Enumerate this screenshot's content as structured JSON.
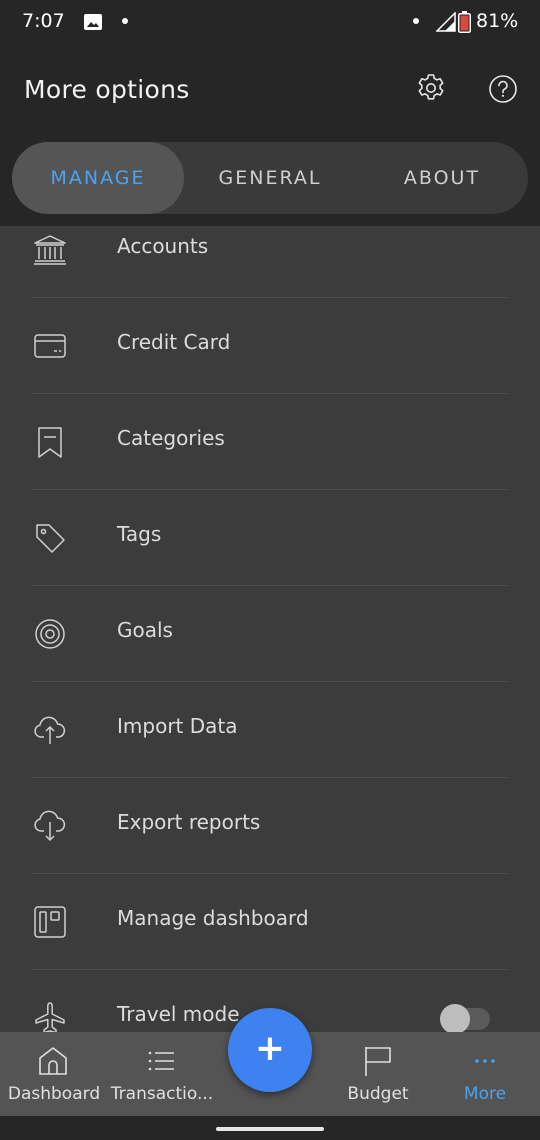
{
  "status_bar": {
    "time": "7:07",
    "battery": "81%"
  },
  "header": {
    "title": "More options",
    "settings_icon": "gear-icon",
    "help_icon": "help-icon"
  },
  "tabs": [
    {
      "label": "MANAGE",
      "active": true
    },
    {
      "label": "GENERAL",
      "active": false
    },
    {
      "label": "ABOUT",
      "active": false
    }
  ],
  "menu": [
    {
      "label": "Accounts",
      "icon": "bank-icon"
    },
    {
      "label": "Credit Card",
      "icon": "credit-card-icon"
    },
    {
      "label": "Categories",
      "icon": "bookmark-icon"
    },
    {
      "label": "Tags",
      "icon": "tag-icon"
    },
    {
      "label": "Goals",
      "icon": "target-icon"
    },
    {
      "label": "Import Data",
      "icon": "cloud-upload-icon"
    },
    {
      "label": "Export reports",
      "icon": "cloud-download-icon"
    },
    {
      "label": "Manage dashboard",
      "icon": "dashboard-layout-icon"
    },
    {
      "label": "Travel mode",
      "icon": "airplane-icon",
      "toggle": false
    }
  ],
  "bottom_nav": [
    {
      "label": "Dashboard",
      "icon": "home-icon",
      "active": false
    },
    {
      "label": "Transactio...",
      "icon": "list-icon",
      "active": false
    },
    {
      "label": "Budget",
      "icon": "flag-icon",
      "active": false
    },
    {
      "label": "More",
      "icon": "more-dots-icon",
      "active": true
    }
  ],
  "fab": {
    "symbol": "+"
  },
  "colors": {
    "accent": "#4aa3f0",
    "fab": "#3d82f0",
    "header_bg": "#262626",
    "list_bg": "#3c3c3c",
    "nav_bg": "#545454"
  }
}
